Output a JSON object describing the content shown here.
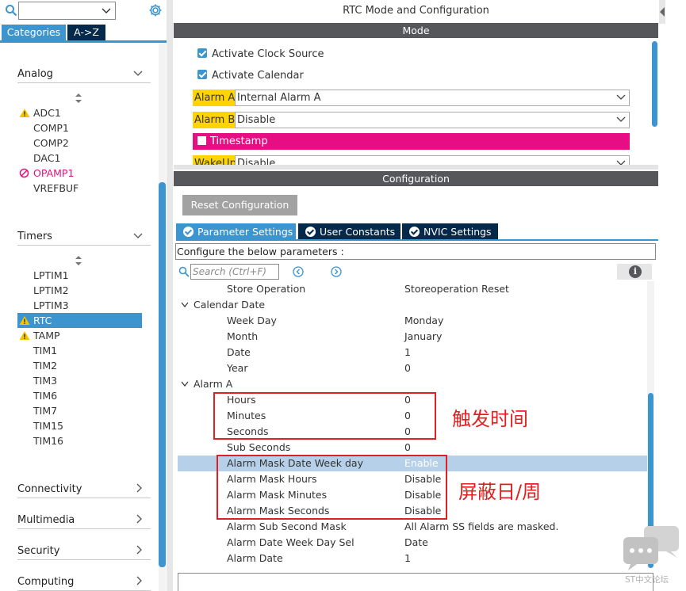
{
  "left": {
    "search": {
      "value": ""
    },
    "tabs": [
      "Categories",
      "A->Z"
    ],
    "categories": [
      {
        "name": "Analog",
        "items": [
          {
            "label": "ADC1",
            "status": "warning"
          },
          {
            "label": "COMP1",
            "status": "none"
          },
          {
            "label": "COMP2",
            "status": "none"
          },
          {
            "label": "DAC1",
            "status": "none"
          },
          {
            "label": "OPAMP1",
            "status": "blocked"
          },
          {
            "label": "VREFBUF",
            "status": "none"
          }
        ]
      },
      {
        "name": "Timers",
        "items": [
          {
            "label": "LPTIM1",
            "status": "none"
          },
          {
            "label": "LPTIM2",
            "status": "none"
          },
          {
            "label": "LPTIM3",
            "status": "none"
          },
          {
            "label": "RTC",
            "status": "warning",
            "selected": true
          },
          {
            "label": "TAMP",
            "status": "warning"
          },
          {
            "label": "TIM1",
            "status": "none"
          },
          {
            "label": "TIM2",
            "status": "none"
          },
          {
            "label": "TIM3",
            "status": "none"
          },
          {
            "label": "TIM6",
            "status": "none"
          },
          {
            "label": "TIM7",
            "status": "none"
          },
          {
            "label": "TIM15",
            "status": "none"
          },
          {
            "label": "TIM16",
            "status": "none"
          }
        ]
      },
      {
        "name": "Connectivity",
        "collapsed": true
      },
      {
        "name": "Multimedia",
        "collapsed": true
      },
      {
        "name": "Security",
        "collapsed": true
      },
      {
        "name": "Computing",
        "collapsed": true
      }
    ]
  },
  "mode": {
    "title": "RTC Mode and Configuration",
    "header": "Mode",
    "activate_clock": "Activate Clock Source",
    "activate_calendar": "Activate Calendar",
    "alarm_a_label": "Alarm A",
    "alarm_a_value": "Internal Alarm A",
    "alarm_b_label": "Alarm B",
    "alarm_b_value": "Disable",
    "timestamp": "Timestamp",
    "wakeup_label": "WakeUp",
    "wakeup_value": "Disable"
  },
  "config": {
    "header": "Configuration",
    "reset_button": "Reset Configuration",
    "tabs": [
      "Parameter Settings",
      "User Constants",
      "NVIC Settings"
    ],
    "below_label": "Configure the below parameters :",
    "search_placeholder": "Search (Ctrl+F)",
    "params": [
      {
        "name": "Store Operation",
        "value": "Storeoperation Reset",
        "group": false
      },
      {
        "name": "Calendar Date",
        "value": "",
        "group": true
      },
      {
        "name": "Week Day",
        "value": "Monday",
        "group": false
      },
      {
        "name": "Month",
        "value": "January",
        "group": false
      },
      {
        "name": "Date",
        "value": "1",
        "group": false
      },
      {
        "name": "Year",
        "value": "0",
        "group": false
      },
      {
        "name": "Alarm A",
        "value": "",
        "group": true
      },
      {
        "name": "Hours",
        "value": "0",
        "group": false
      },
      {
        "name": "Minutes",
        "value": "0",
        "group": false
      },
      {
        "name": "Seconds",
        "value": "0",
        "group": false
      },
      {
        "name": "Sub Seconds",
        "value": "0",
        "group": false
      },
      {
        "name": "Alarm Mask Date Week day",
        "value": "Enable",
        "group": false,
        "selected": true
      },
      {
        "name": "Alarm Mask Hours",
        "value": "Disable",
        "group": false
      },
      {
        "name": "Alarm Mask Minutes",
        "value": "Disable",
        "group": false
      },
      {
        "name": "Alarm Mask Seconds",
        "value": "Disable",
        "group": false
      },
      {
        "name": "Alarm Sub Second Mask",
        "value": "All Alarm SS fields are masked.",
        "group": false
      },
      {
        "name": "Alarm Date Week Day Sel",
        "value": "Date",
        "group": false
      },
      {
        "name": "Alarm Date",
        "value": "1",
        "group": false
      }
    ]
  },
  "annotations": {
    "trigger_time": "触发时间",
    "mask_day": "屏蔽日/周"
  },
  "watermark": "ST中文论坛",
  "colors": {
    "accent": "#3c95cf",
    "dark_navy": "#05294b",
    "header_gray": "#55575a",
    "highlight_yellow": "#ffd400",
    "timestamp_pink": "#e60e82",
    "annotation_red": "#e02020"
  }
}
